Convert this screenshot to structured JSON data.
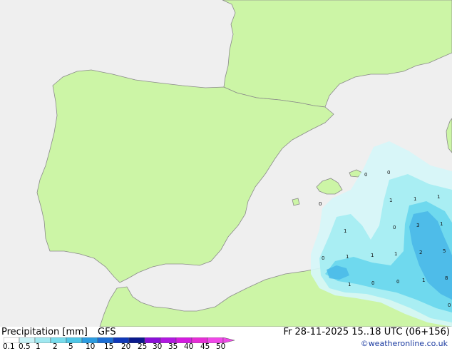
{
  "map": {
    "region": "Iberian Peninsula and western Mediterranean",
    "colors": {
      "sea": "#efefef",
      "land": "#ccf5a6",
      "coast": "#8a8a8a",
      "precip_light": "#d6f6f8",
      "precip_mid": "#a9eef3",
      "precip_high": "#6fd9ee",
      "precip_max": "#4ab8e8"
    },
    "point_labels": [
      {
        "text": "0"
      },
      {
        "text": "0"
      },
      {
        "text": "0"
      },
      {
        "text": "1"
      },
      {
        "text": "1"
      },
      {
        "text": "1"
      },
      {
        "text": "0"
      },
      {
        "text": "3"
      },
      {
        "text": "1"
      },
      {
        "text": "1"
      },
      {
        "text": "0"
      },
      {
        "text": "1"
      },
      {
        "text": "1"
      },
      {
        "text": "1"
      },
      {
        "text": "2"
      },
      {
        "text": "5"
      },
      {
        "text": "1"
      },
      {
        "text": "0"
      },
      {
        "text": "0"
      },
      {
        "text": "1"
      },
      {
        "text": "8"
      },
      {
        "text": "0"
      }
    ]
  },
  "legend": {
    "title": "Precipitation [mm]",
    "model": "GFS",
    "valid_time": "Fr 28-11-2025 15..18 UTC (06+156)",
    "credit": "©weatheronline.co.uk",
    "ticks": [
      "0.1",
      "0.5",
      "1",
      "2",
      "5",
      "10",
      "15",
      "20",
      "25",
      "30",
      "35",
      "40",
      "45",
      "50"
    ],
    "colors": [
      "#ffffff",
      "#c8f2f6",
      "#a0e8f0",
      "#78dcec",
      "#4fc6e6",
      "#2c9ce0",
      "#1d6ed4",
      "#1038b8",
      "#0a1a8c",
      "#8a10d8",
      "#b018e0",
      "#d41ce0",
      "#e62ed6",
      "#f048e8"
    ]
  }
}
